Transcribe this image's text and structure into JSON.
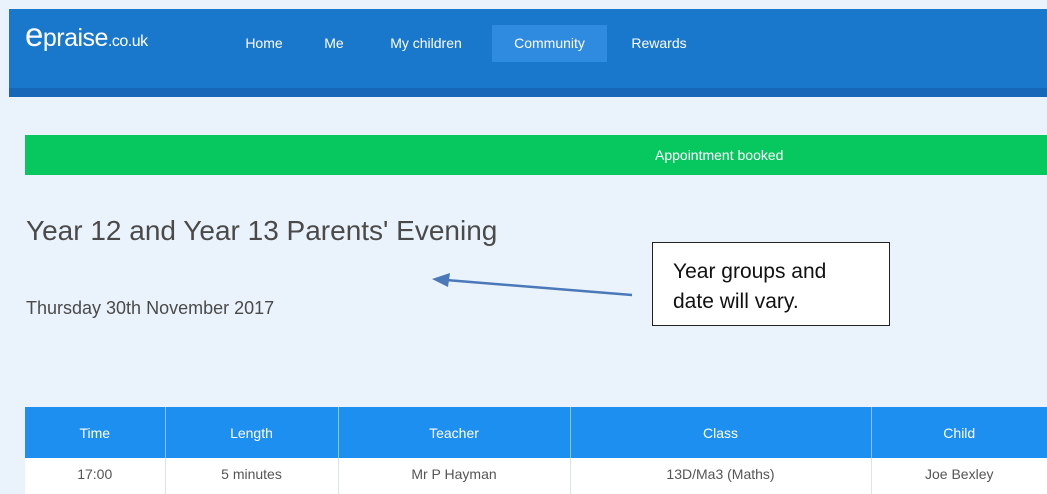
{
  "app": {
    "logo_main": "praise",
    "logo_e": "e",
    "logo_tld": ".co.uk"
  },
  "nav": {
    "items": [
      "Home",
      "Me",
      "My children",
      "Community",
      "Rewards"
    ],
    "active": "Community"
  },
  "alert": {
    "message": "Appointment booked"
  },
  "event": {
    "title": "Year 12 and Year 13 Parents' Evening",
    "date": "Thursday 30th November 2017"
  },
  "callout": {
    "line1": "Year groups and",
    "line2": "date will vary."
  },
  "table": {
    "headers": [
      "Time",
      "Length",
      "Teacher",
      "Class",
      "Child"
    ],
    "rows": [
      [
        "17:00",
        "5 minutes",
        "Mr P Hayman",
        "13D/Ma3 (Maths)",
        "Joe Bexley"
      ]
    ]
  },
  "colors": {
    "header_bg": "#1a78cc",
    "nav_active": "#2f8be0",
    "success": "#06c85f",
    "table_header": "#1d8ff0",
    "page_bg": "#eaf3fb"
  }
}
